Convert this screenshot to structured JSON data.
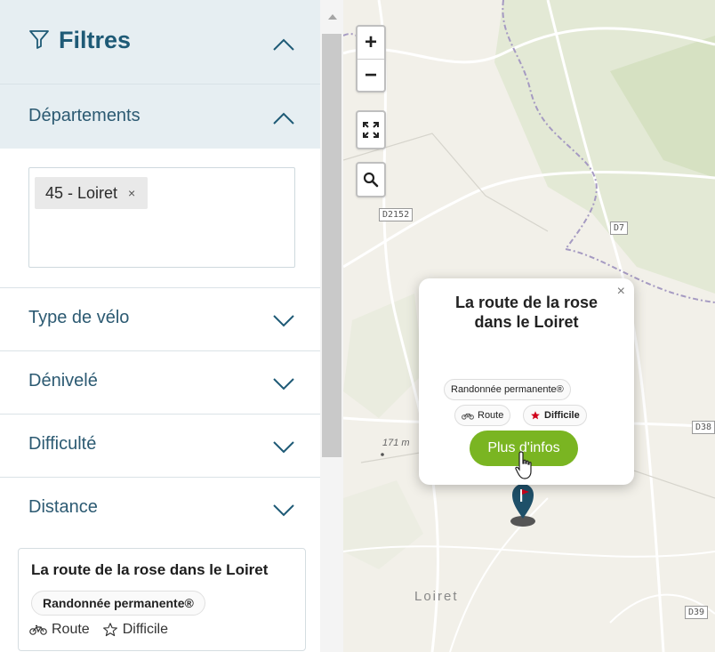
{
  "sidebar": {
    "filters_title": "Filtres",
    "departments_title": "Départements",
    "department_tag": "45 - Loiret",
    "department_tag_remove": "×",
    "filter_rows": [
      {
        "label": "Type de vélo"
      },
      {
        "label": "Dénivelé"
      },
      {
        "label": "Difficulté"
      },
      {
        "label": "Distance"
      }
    ],
    "result_card": {
      "title": "La route de la rose dans le Loiret",
      "badge": "Randonnée permanente®",
      "type": "Route",
      "difficulty": "Difficile"
    }
  },
  "map": {
    "zoom_in": "+",
    "zoom_out": "−",
    "road_labels": [
      "D2152",
      "D7",
      "D38",
      "D39"
    ],
    "elevation_label": "171 m",
    "place_label": "Loiret",
    "popup": {
      "close": "×",
      "title": "La route de la rose dans le Loiret",
      "badge": "Randonnée permanente®",
      "type": "Route",
      "difficulty": "Difficile",
      "button": "Plus d'infos"
    }
  },
  "colors": {
    "header_bg": "#e6eef2",
    "primary_text": "#1e5a76",
    "button_green": "#7ab522",
    "difficulty_star": "#d0021b"
  }
}
